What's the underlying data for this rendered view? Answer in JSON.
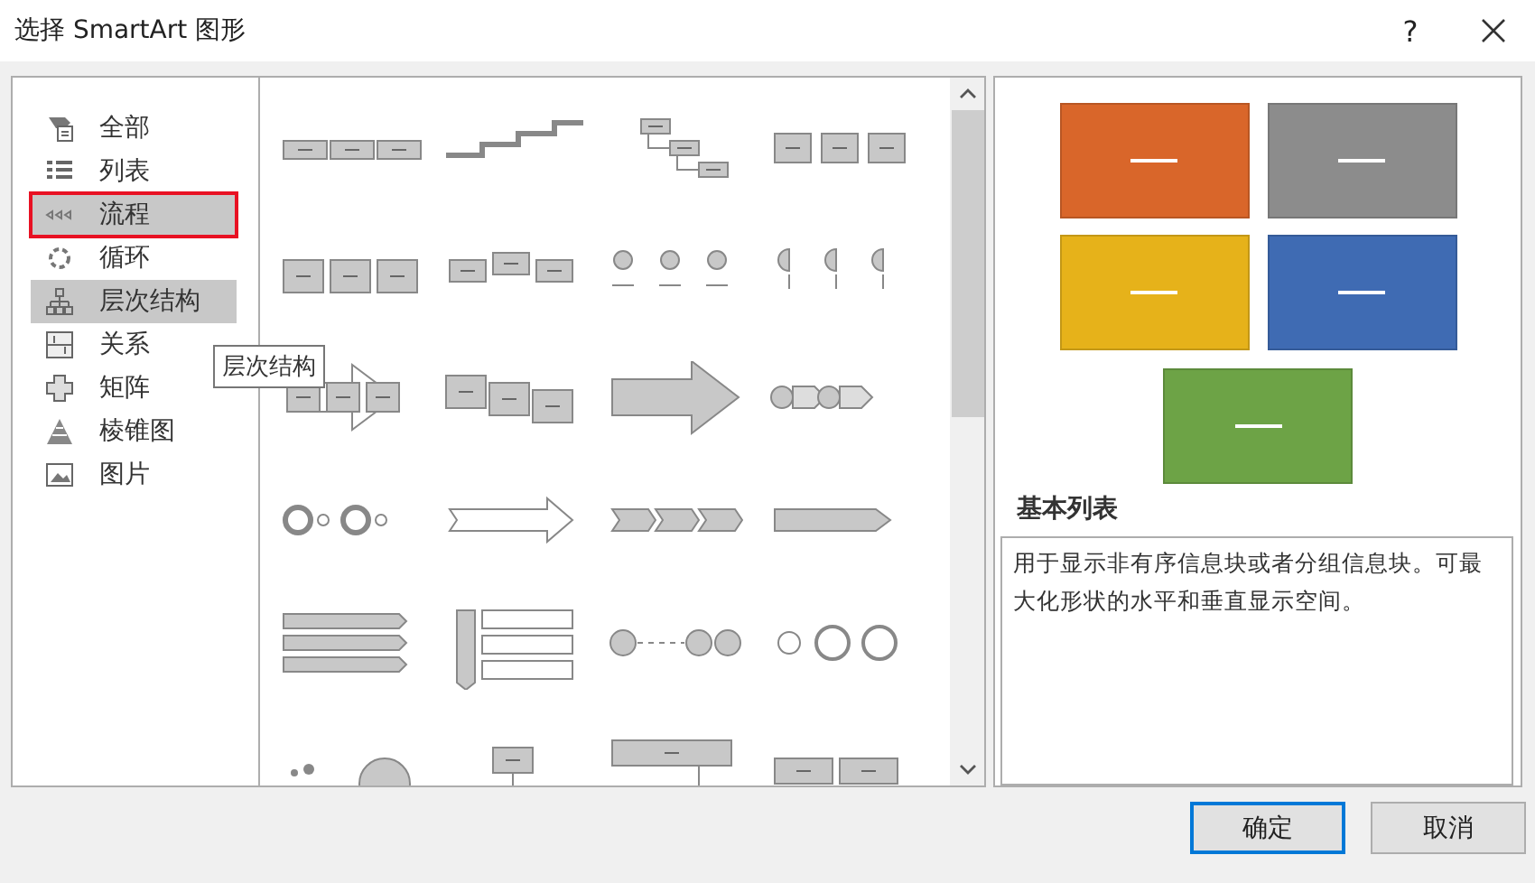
{
  "window": {
    "title": "选择 SmartArt 图形",
    "help": "?"
  },
  "categories": [
    {
      "label": "全部",
      "kind": "all",
      "selected": false,
      "hovered": false
    },
    {
      "label": "列表",
      "kind": "list",
      "selected": false,
      "hovered": false
    },
    {
      "label": "流程",
      "kind": "process",
      "selected": true,
      "hovered": false
    },
    {
      "label": "循环",
      "kind": "cycle",
      "selected": false,
      "hovered": false
    },
    {
      "label": "层次结构",
      "kind": "hierarchy",
      "selected": false,
      "hovered": true
    },
    {
      "label": "关系",
      "kind": "relationship",
      "selected": false,
      "hovered": false
    },
    {
      "label": "矩阵",
      "kind": "matrix",
      "selected": false,
      "hovered": false
    },
    {
      "label": "棱锥图",
      "kind": "pyramid",
      "selected": false,
      "hovered": false
    },
    {
      "label": "图片",
      "kind": "picture",
      "selected": false,
      "hovered": false
    }
  ],
  "tooltip": "层次结构",
  "preview": {
    "shapes": [
      {
        "color": "#d9662a"
      },
      {
        "color": "#8c8c8c"
      },
      {
        "color": "#e6b21a"
      },
      {
        "color": "#3f6bb3"
      },
      {
        "color": "#6da346"
      }
    ],
    "title": "基本列表",
    "description": "用于显示非有序信息块或者分组信息块。可最大化形状的水平和垂直显示空间。"
  },
  "buttons": [
    {
      "label": "确定",
      "focused": true
    },
    {
      "label": "取消",
      "focused": false
    }
  ]
}
